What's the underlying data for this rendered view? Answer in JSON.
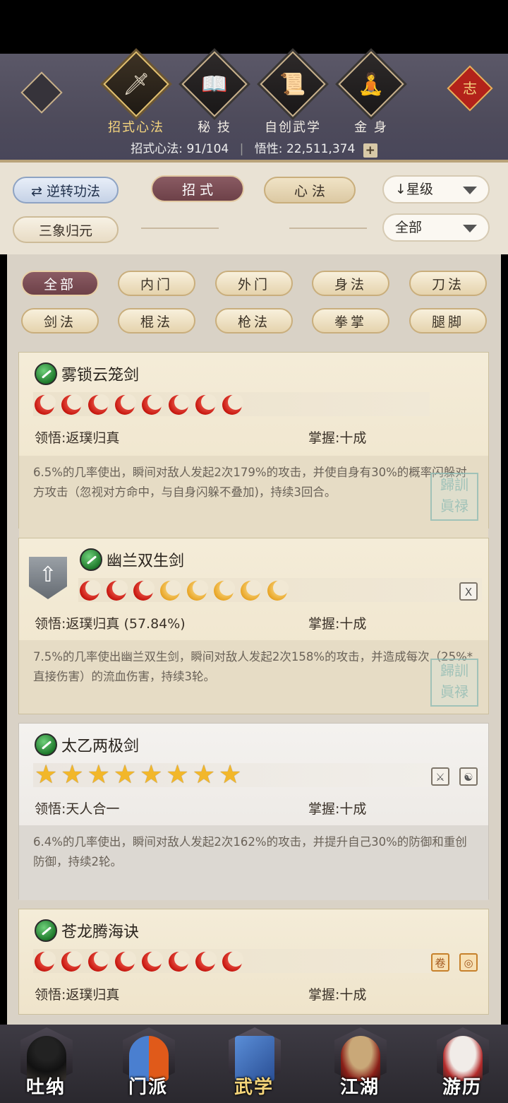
{
  "top_nav": {
    "items": [
      {
        "label": "招式心法",
        "icon": "sword-icon",
        "active": true
      },
      {
        "label": "秘 技",
        "icon": "book-icon",
        "active": false
      },
      {
        "label": "自创武学",
        "icon": "scroll-icon",
        "active": false
      },
      {
        "label": "金 身",
        "icon": "meditation-icon",
        "active": false
      }
    ],
    "knot_label": "志",
    "stats": {
      "zhaoshi_label": "招式心法:",
      "zhaoshi_value": "91/104",
      "wuxing_label": "悟性:",
      "wuxing_value": "22,511,374",
      "plus": "+"
    }
  },
  "filters": {
    "reverse_btn": "逆转功法",
    "tab_zhaoshi": "招 式",
    "tab_xinfa": "心 法",
    "sort_dropdown": "↓星级",
    "sanxiang_btn": "三象归元",
    "range_dropdown": "全部"
  },
  "categories": [
    "全部",
    "内门",
    "外门",
    "身法",
    "刀法",
    "剑法",
    "棍法",
    "枪法",
    "拳掌",
    "腿脚"
  ],
  "skills": [
    {
      "name": "雾锁云笼剑",
      "rank_type": "red-moon",
      "red": 8,
      "gold": 0,
      "comprehend_label": "领悟:",
      "comprehend": "返璞归真",
      "mastery_label": "掌握:",
      "mastery": "十成",
      "desc": "6.5%的几率使出，瞬间对敌人发起2次179%的攻击，并使自身有30%的概率闪躲对方攻击（忽视对方命中，与自身闪躲不叠加)，持续3回合。",
      "stamp": "归真 初禄"
    },
    {
      "name": "幽兰双生剑",
      "rank_type": "mixed-moon",
      "red": 3,
      "gold": 5,
      "comprehend_label": "领悟:",
      "comprehend": "返璞归真 (57.84%)",
      "mastery_label": "掌握:",
      "mastery": "十成",
      "desc": "7.5%的几率使出幽兰双生剑，瞬间对敌人发起2次158%的攻击，并造成每次（25%*直接伤害）的流血伤害，持续3轮。",
      "badge": "X",
      "stamp": "归真 初禄"
    },
    {
      "name": "太乙两极剑",
      "rank_type": "star",
      "stars": 8,
      "comprehend_label": "领悟:",
      "comprehend": "天人合一",
      "mastery_label": "掌握:",
      "mastery": "十成",
      "desc": "6.4%的几率使出，瞬间对敌人发起2次162%的攻击，并提升自己30%的防御和重创防御，持续2轮。",
      "badges": [
        "⚔",
        "☯"
      ]
    },
    {
      "name": "苍龙腾海诀",
      "rank_type": "red-moon",
      "red": 8,
      "gold": 0,
      "comprehend_label": "领悟:",
      "comprehend": "返璞归真",
      "mastery_label": "掌握:",
      "mastery": "十成",
      "badges": [
        "卷",
        "◎"
      ]
    }
  ],
  "bottom_nav": [
    {
      "label": "吐纳",
      "active": false
    },
    {
      "label": "门派",
      "active": false
    },
    {
      "label": "武学",
      "active": true
    },
    {
      "label": "江湖",
      "active": false
    },
    {
      "label": "游历",
      "active": false
    }
  ]
}
